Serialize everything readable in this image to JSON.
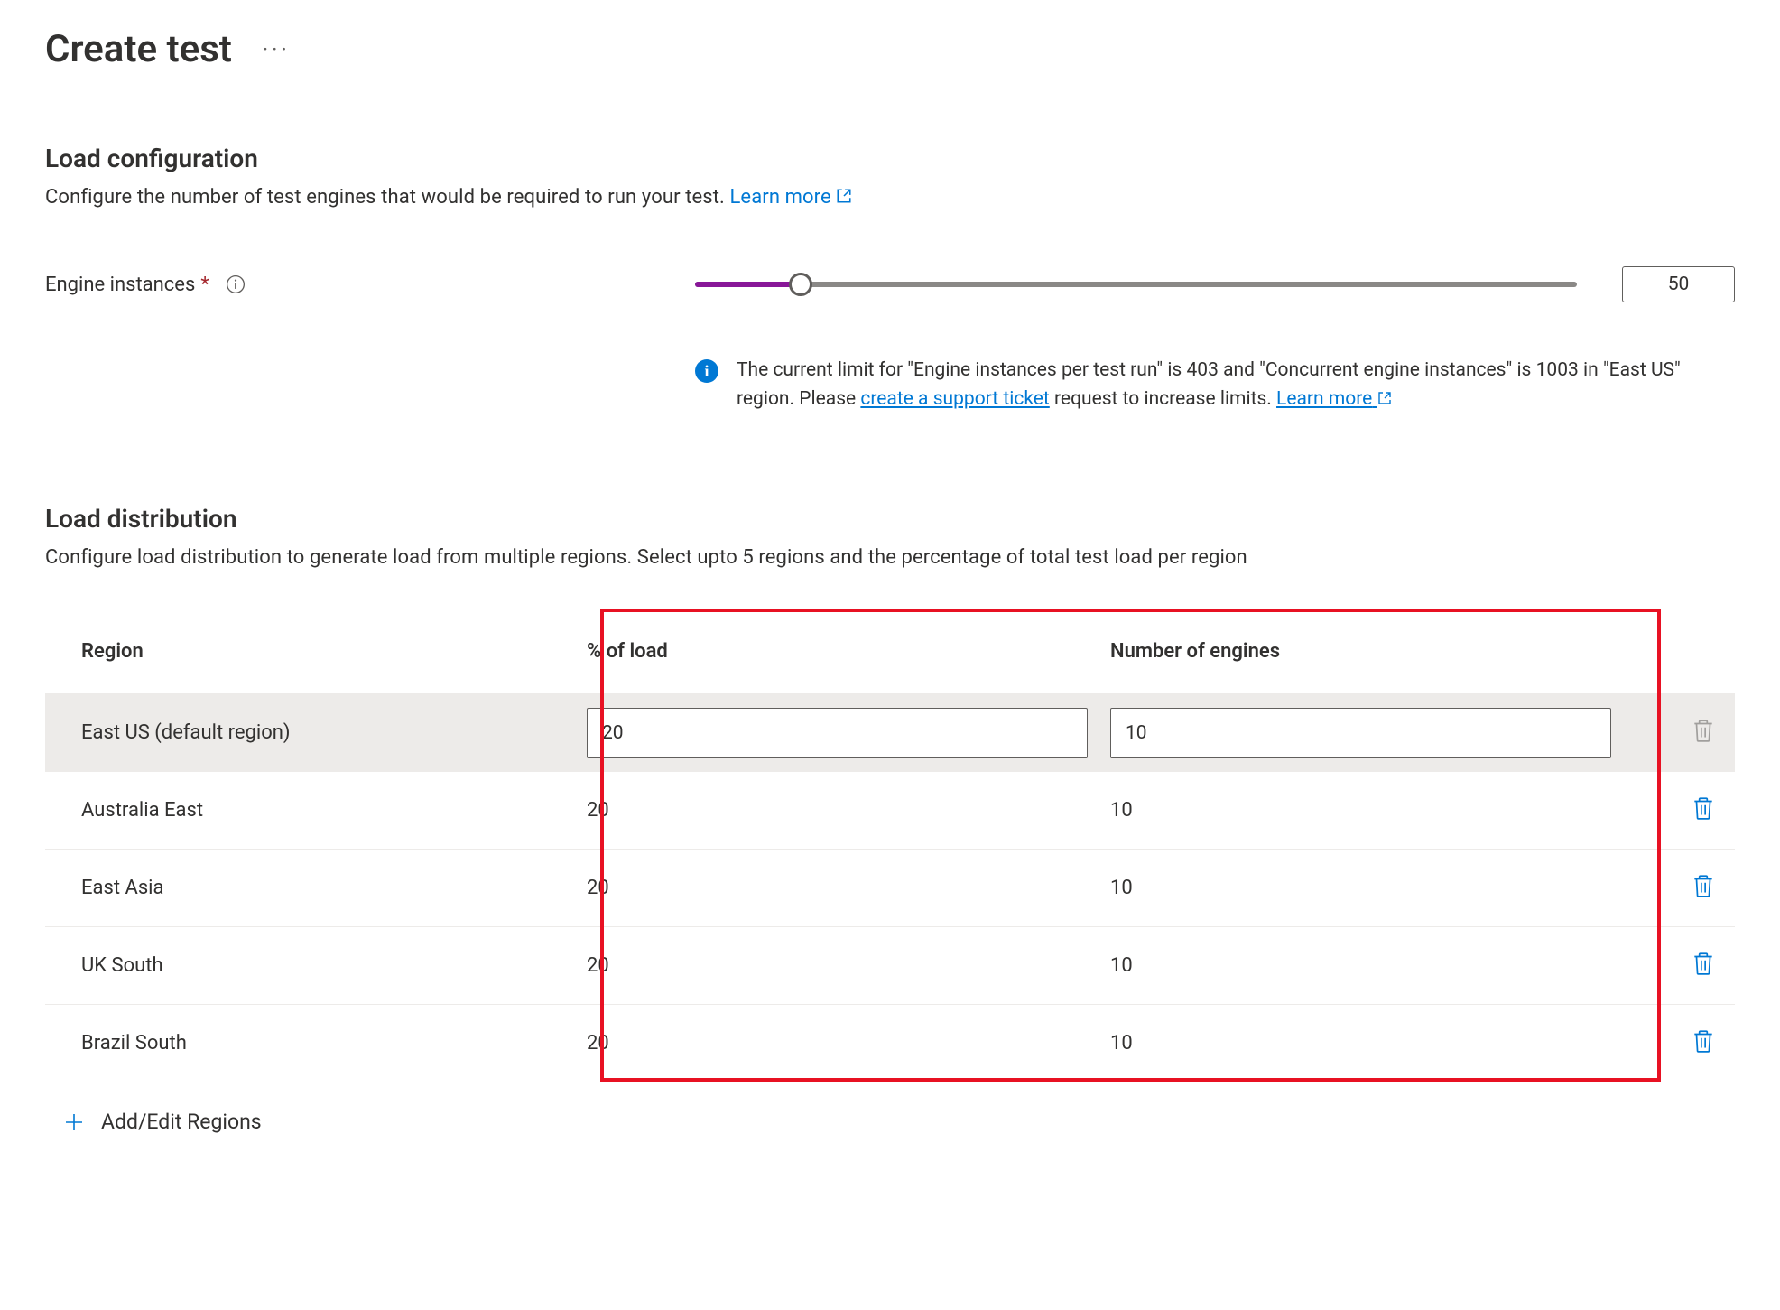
{
  "header": {
    "title": "Create test"
  },
  "load_config": {
    "heading": "Load configuration",
    "description": "Configure the number of test engines that would be required to run your test. ",
    "learn_more": "Learn more",
    "label": "Engine instances",
    "value": "50",
    "slider_percent": 12
  },
  "info": {
    "text1": "The current limit for \"Engine instances per test run\" is 403 and \"Concurrent engine instances\" is 1003 in \"East US\" region. Please ",
    "support_link": "create a support ticket",
    "text2": " request to increase limits. ",
    "learn_more": "Learn more"
  },
  "distribution": {
    "heading": "Load distribution",
    "description": "Configure load distribution to generate load from multiple regions. Select upto 5 regions and the percentage of total test load per region",
    "columns": {
      "region": "Region",
      "load": "% of load",
      "engines": "Number of engines"
    },
    "rows": [
      {
        "region": "East US (default region)",
        "load": "20",
        "engines": "10",
        "selected": true,
        "deletable": false
      },
      {
        "region": "Australia East",
        "load": "20",
        "engines": "10",
        "selected": false,
        "deletable": true
      },
      {
        "region": "East Asia",
        "load": "20",
        "engines": "10",
        "selected": false,
        "deletable": true
      },
      {
        "region": "UK South",
        "load": "20",
        "engines": "10",
        "selected": false,
        "deletable": true
      },
      {
        "region": "Brazil South",
        "load": "20",
        "engines": "10",
        "selected": false,
        "deletable": true
      }
    ],
    "add_label": "Add/Edit Regions"
  }
}
